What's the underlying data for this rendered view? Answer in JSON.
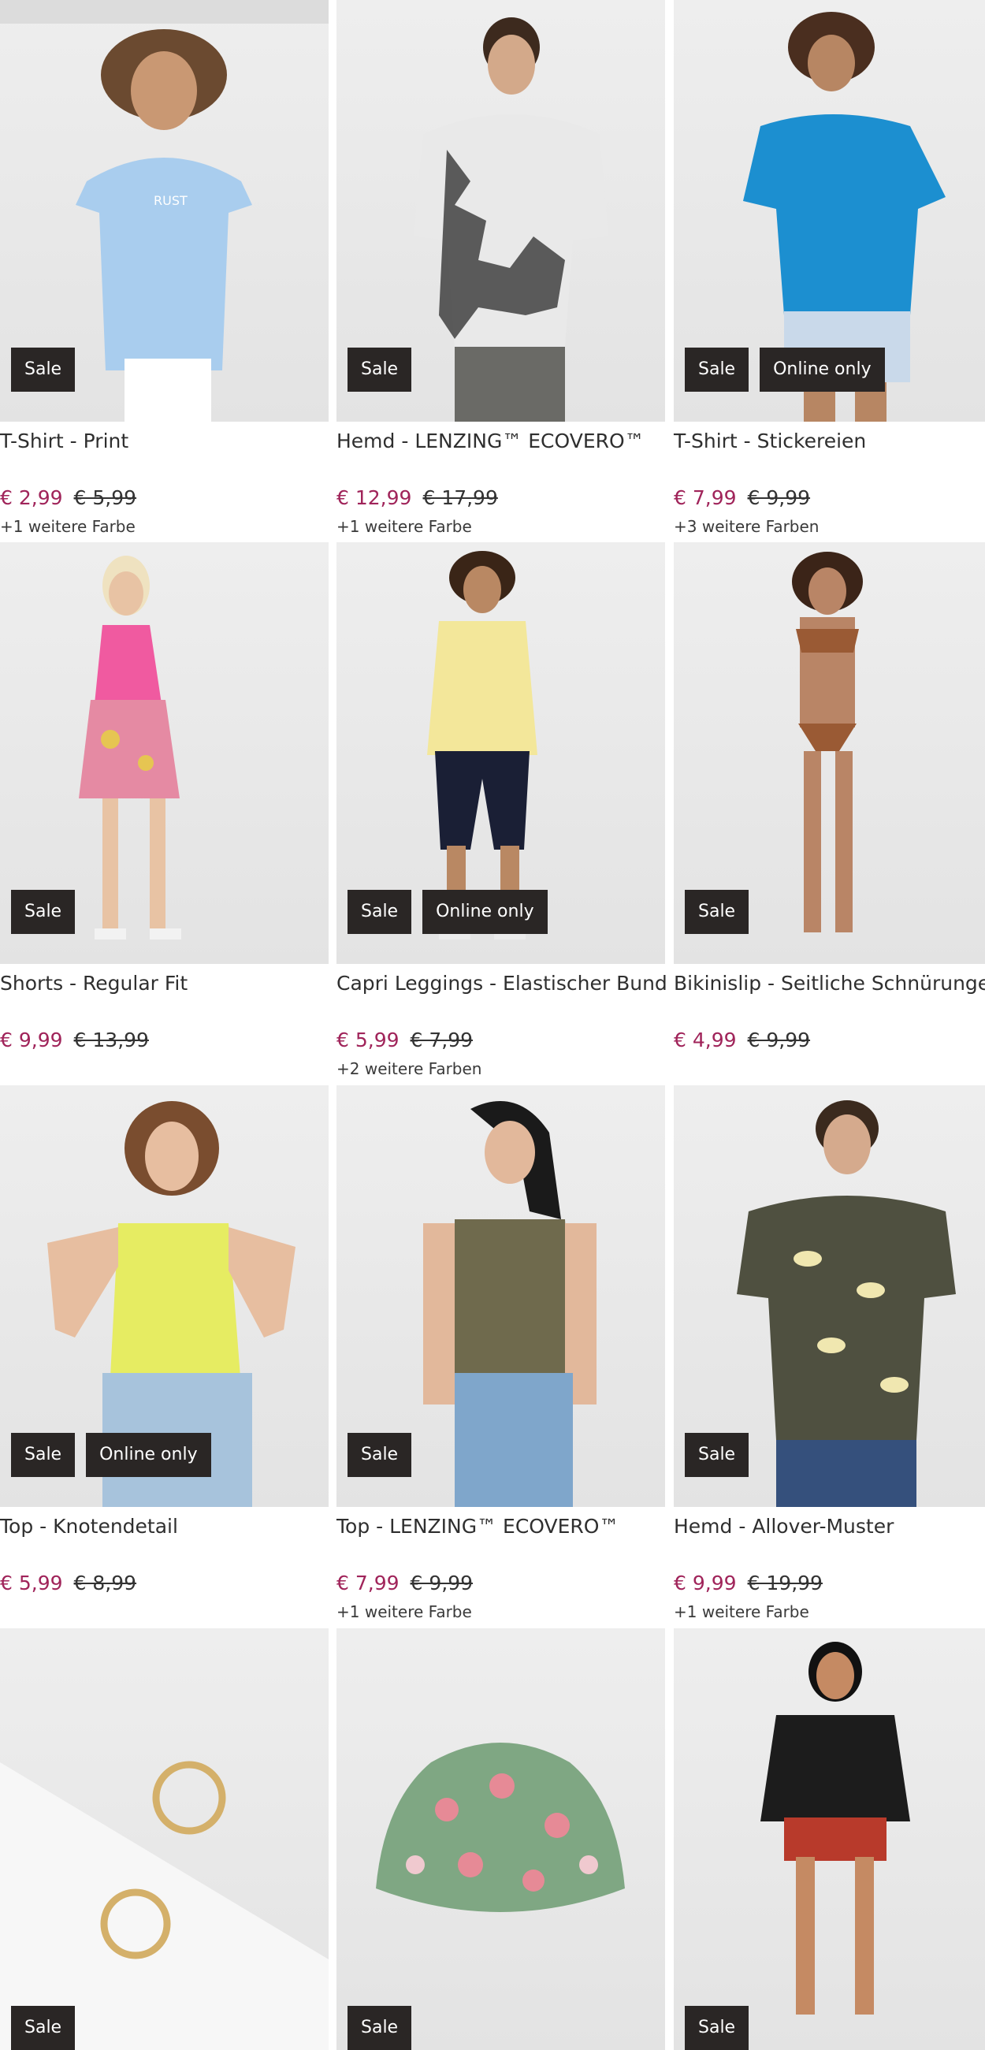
{
  "products": [
    {
      "title": "T-Shirt - Print",
      "price": "€ 2,99",
      "old_price": "€ 5,99",
      "colors": "+1 weitere Farbe",
      "badges": [
        "Sale"
      ],
      "garment_color": "#a9cdee"
    },
    {
      "title": "Hemd - LENZING™ ECOVERO™",
      "price": "€ 12,99",
      "old_price": "€ 17,99",
      "colors": "+1 weitere Farbe",
      "badges": [
        "Sale"
      ],
      "garment_color": "#d8d8d8"
    },
    {
      "title": "T-Shirt - Stickereien",
      "price": "€ 7,99",
      "old_price": "€ 9,99",
      "colors": "+3 weitere Farben",
      "badges": [
        "Sale",
        "Online only"
      ],
      "garment_color": "#1c8fd0"
    },
    {
      "title": "Shorts - Regular Fit",
      "price": "€ 9,99",
      "old_price": "€ 13,99",
      "colors": "",
      "badges": [
        "Sale"
      ],
      "garment_color": "#f05aa0"
    },
    {
      "title": "Capri Leggings - Elastischer Bund",
      "price": "€ 5,99",
      "old_price": "€ 7,99",
      "colors": "+2 weitere Farben",
      "badges": [
        "Sale",
        "Online only"
      ],
      "garment_color": "#f3e79a"
    },
    {
      "title": "Bikinislip - Seitliche Schnürungen",
      "price": "€ 4,99",
      "old_price": "€ 9,99",
      "colors": "",
      "badges": [
        "Sale"
      ],
      "garment_color": "#9a5a34"
    },
    {
      "title": "Top - Knotendetail",
      "price": "€ 5,99",
      "old_price": "€ 8,99",
      "colors": "",
      "badges": [
        "Sale",
        "Online only"
      ],
      "garment_color": "#e6ec62"
    },
    {
      "title": "Top - LENZING™ ECOVERO™",
      "price": "€ 7,99",
      "old_price": "€ 9,99",
      "colors": "+1 weitere Farbe",
      "badges": [
        "Sale"
      ],
      "garment_color": "#6f6a4d"
    },
    {
      "title": "Hemd - Allover-Muster",
      "price": "€ 9,99",
      "old_price": "€ 19,99",
      "colors": "+1 weitere Farbe",
      "badges": [
        "Sale"
      ],
      "garment_color": "#4f5040"
    },
    {
      "title": "",
      "price": "",
      "old_price": "",
      "colors": "",
      "badges": [
        "Sale"
      ],
      "garment_color": "#d4b06a"
    },
    {
      "title": "",
      "price": "",
      "old_price": "",
      "colors": "",
      "badges": [
        "Sale"
      ],
      "garment_color": "#e68a96"
    },
    {
      "title": "",
      "price": "",
      "old_price": "",
      "colors": "",
      "badges": [
        "Sale"
      ],
      "garment_color": "#1c1c1c"
    }
  ]
}
